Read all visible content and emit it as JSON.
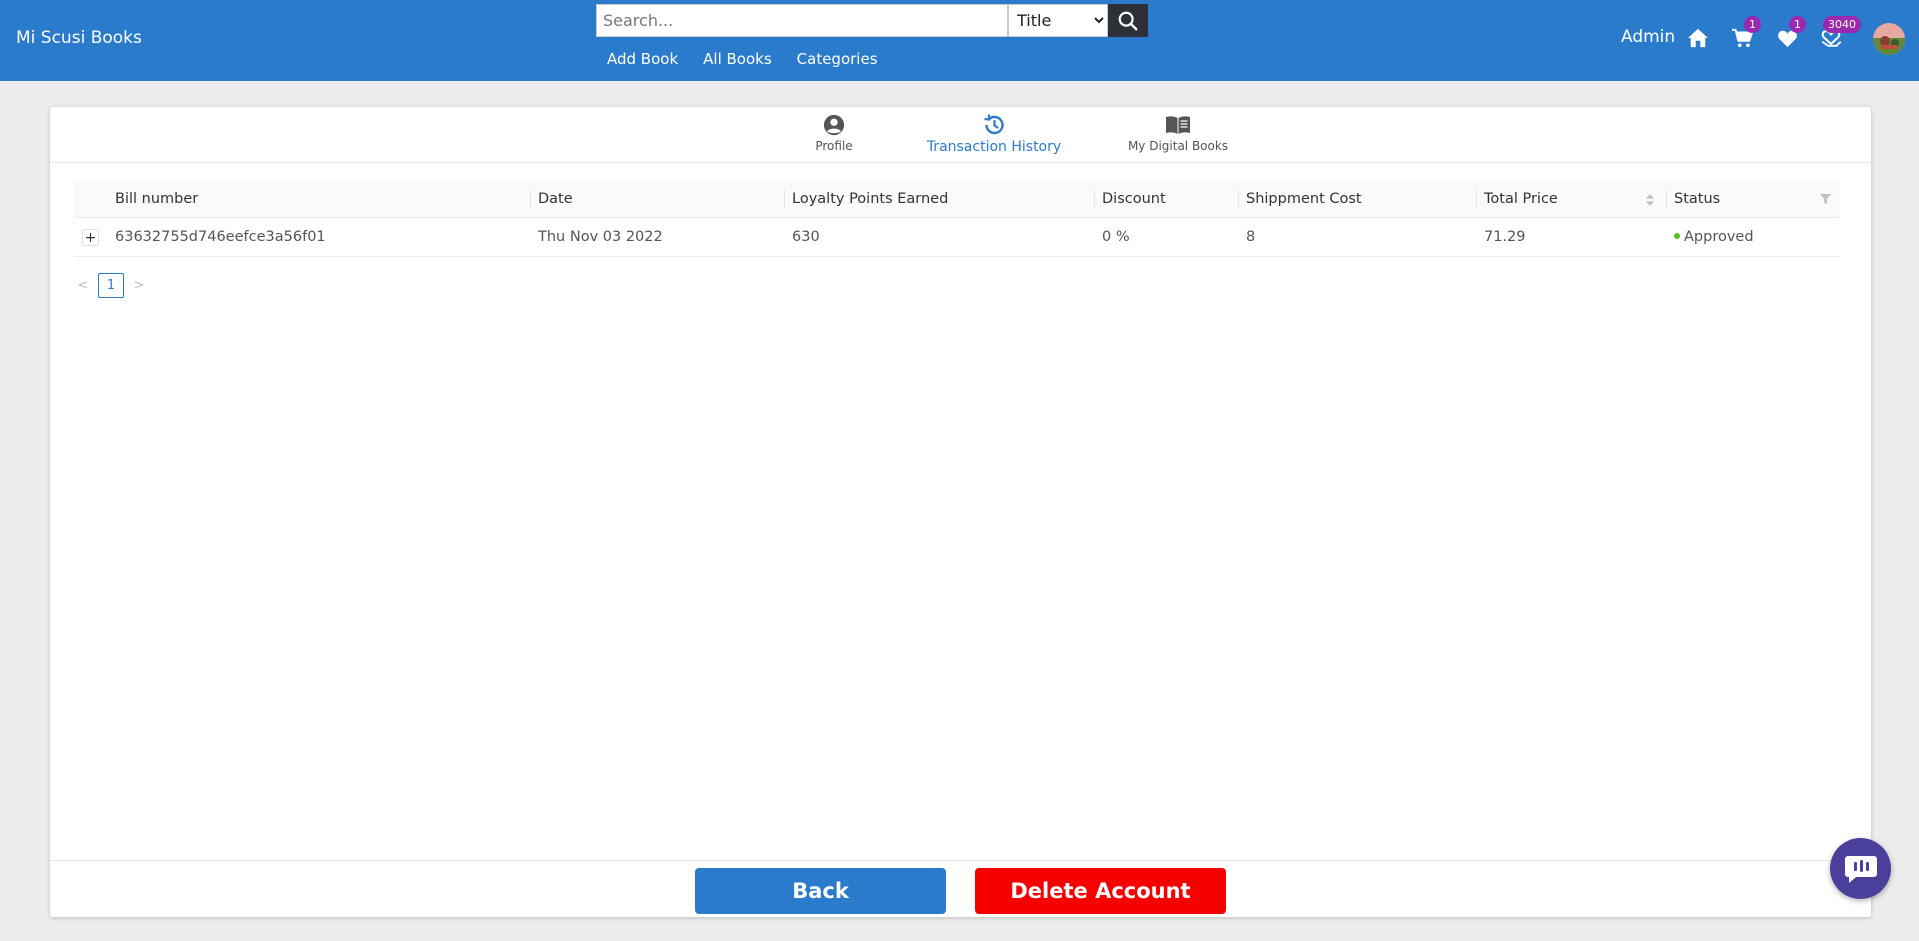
{
  "header": {
    "brand": "Mi Scusi Books",
    "search_placeholder": "Search...",
    "search_type_selected": "Title",
    "nav": [
      "Add Book",
      "All Books",
      "Categories"
    ],
    "user_label": "Admin",
    "cart_count": "1",
    "wishlist_count": "1",
    "points_count": "3040"
  },
  "tabs": [
    {
      "label": "Profile",
      "icon": "user-circle-icon",
      "active": false
    },
    {
      "label": "Transaction History",
      "icon": "history-icon",
      "active": true
    },
    {
      "label": "My Digital Books",
      "icon": "book-open-icon",
      "active": false
    }
  ],
  "table": {
    "columns": [
      "Bill number",
      "Date",
      "Loyalty Points Earned",
      "Discount",
      "Shippment Cost",
      "Total Price",
      "Status"
    ],
    "rows": [
      {
        "bill_number": "63632755d746eefce3a56f01",
        "date": "Thu Nov 03 2022",
        "loyalty_points": "630",
        "discount": "0 %",
        "shipment_cost": "8",
        "total_price": "71.29",
        "status": "Approved"
      }
    ]
  },
  "pagination": {
    "current": "1",
    "prev": "<",
    "next": ">"
  },
  "footer": {
    "back_label": "Back",
    "delete_label": "Delete Account"
  },
  "colors": {
    "primary": "#2b7bcc",
    "danger": "#f60000",
    "badge": "#9c27b0",
    "status_ok": "#52c41a"
  }
}
